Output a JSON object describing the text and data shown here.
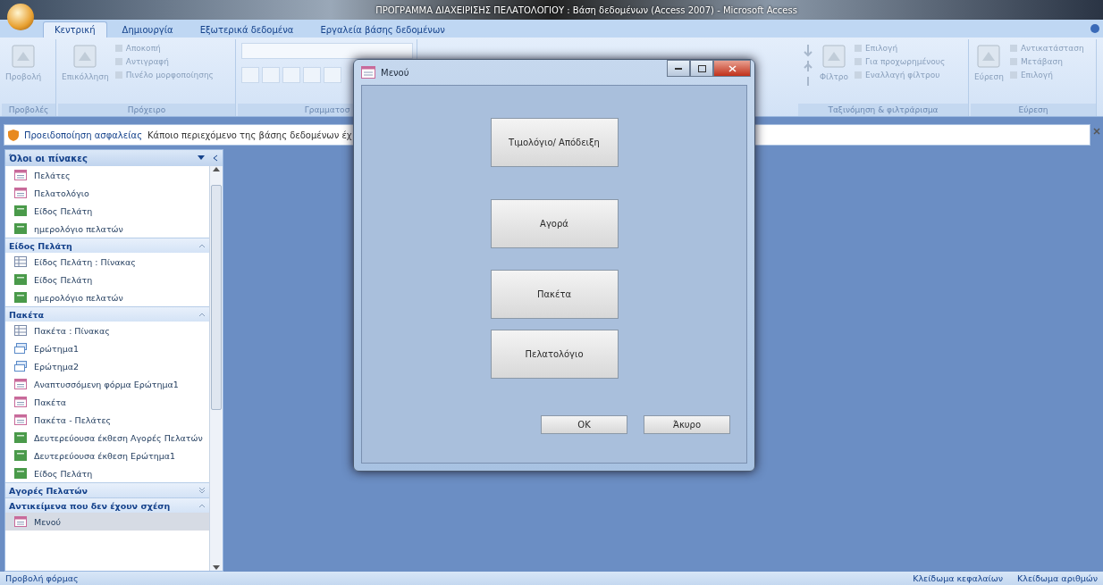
{
  "window": {
    "title": "ΠΡΟΓΡΑΜΜΑ ΔΙΑΧΕΙΡΙΣΗΣ ΠΕΛΑΤΟΛΟΓΙΟΥ : Βάση δεδομένων (Access 2007) - Microsoft Access"
  },
  "tabs": [
    {
      "label": "Κεντρική",
      "selected": true
    },
    {
      "label": "Δημιουργία",
      "selected": false
    },
    {
      "label": "Εξωτερικά δεδομένα",
      "selected": false
    },
    {
      "label": "Εργαλεία βάσης δεδομένων",
      "selected": false
    }
  ],
  "ribbon": {
    "groups": [
      {
        "label": "Προβολές",
        "items": [
          {
            "label": "Προβολή",
            "kind": "large"
          }
        ]
      },
      {
        "label": "Πρόχειρο",
        "items": [
          {
            "label": "Επικόλληση",
            "kind": "large"
          },
          {
            "label": "Αποκοπή",
            "kind": "small"
          },
          {
            "label": "Αντιγραφή",
            "kind": "small"
          },
          {
            "label": "Πινέλο μορφοποίησης",
            "kind": "small"
          }
        ]
      },
      {
        "label": "Γραμματοσ",
        "items": [
          {
            "kind": "font"
          }
        ]
      },
      {
        "label": "Ταξινόμηση & φιλτράρισμα",
        "items": [
          {
            "kind": "sort"
          },
          {
            "label": "Φίλτρο",
            "kind": "large"
          },
          {
            "label": "Επιλογή",
            "kind": "small"
          },
          {
            "label": "Για προχωρημένους",
            "kind": "small"
          },
          {
            "label": "Εναλλαγή φίλτρου",
            "kind": "small"
          }
        ]
      },
      {
        "label": "Εύρεση",
        "items": [
          {
            "label": "Εύρεση",
            "kind": "large"
          },
          {
            "label": "Αντικατάσταση",
            "kind": "small"
          },
          {
            "label": "Μετάβαση",
            "kind": "small"
          },
          {
            "label": "Επιλογή",
            "kind": "small"
          }
        ]
      }
    ]
  },
  "security_bar": {
    "title": "Προειδοποίηση ασφαλείας",
    "message": "Κάποιο περιεχόμενο της βάσης δεδομένων έχ"
  },
  "nav": {
    "title": "Όλοι οι πίνακες",
    "sections": [
      {
        "items": [
          {
            "label": "Πελάτες",
            "kind": "form",
            "selected": false
          },
          {
            "label": "Πελατολόγιο",
            "kind": "form",
            "selected": false
          },
          {
            "label": "Είδος Πελάτη",
            "kind": "report",
            "selected": false
          },
          {
            "label": "ημερολόγιο πελατών",
            "kind": "report",
            "selected": false
          }
        ]
      },
      {
        "title": "Είδος Πελάτη",
        "expanded": true,
        "items": [
          {
            "label": "Είδος Πελάτη : Πίνακας",
            "kind": "table",
            "selected": false
          },
          {
            "label": "Είδος Πελάτη",
            "kind": "report",
            "selected": false
          },
          {
            "label": "ημερολόγιο πελατών",
            "kind": "report",
            "selected": false
          }
        ]
      },
      {
        "title": "Πακέτα",
        "expanded": true,
        "items": [
          {
            "label": "Πακέτα : Πίνακας",
            "kind": "table",
            "selected": false
          },
          {
            "label": "Ερώτημα1",
            "kind": "query",
            "selected": false
          },
          {
            "label": "Ερώτημα2",
            "kind": "query",
            "selected": false
          },
          {
            "label": "Αναπτυσσόμενη φόρμα Ερώτημα1",
            "kind": "form",
            "selected": false
          },
          {
            "label": "Πακέτα",
            "kind": "form",
            "selected": false
          },
          {
            "label": "Πακέτα - Πελάτες",
            "kind": "form",
            "selected": false
          },
          {
            "label": "Δευτερεύουσα έκθεση Αγορές Πελατών",
            "kind": "report",
            "selected": false
          },
          {
            "label": "Δευτερεύουσα έκθεση Ερώτημα1",
            "kind": "report",
            "selected": false
          },
          {
            "label": "Είδος Πελάτη",
            "kind": "report",
            "selected": false
          }
        ]
      },
      {
        "title": "Αγορές Πελατών",
        "expanded": false
      },
      {
        "title": "Αντικείμενα που δεν έχουν σχέση",
        "expanded": true,
        "items": [
          {
            "label": "Μενού",
            "kind": "form",
            "selected": true
          }
        ]
      }
    ]
  },
  "dialog": {
    "title": "Μενού",
    "menu_buttons": [
      "Τιμολόγιο/ Απόδειξη",
      "Αγορά",
      "Πακέτα",
      "Πελατολόγιο"
    ],
    "buttons": [
      "OK",
      "Άκυρο"
    ]
  },
  "status_bar": {
    "left": "Προβολή φόρμας",
    "right": [
      "Κλείδωμα κεφαλαίων",
      "Κλείδωμα αριθμών"
    ]
  }
}
